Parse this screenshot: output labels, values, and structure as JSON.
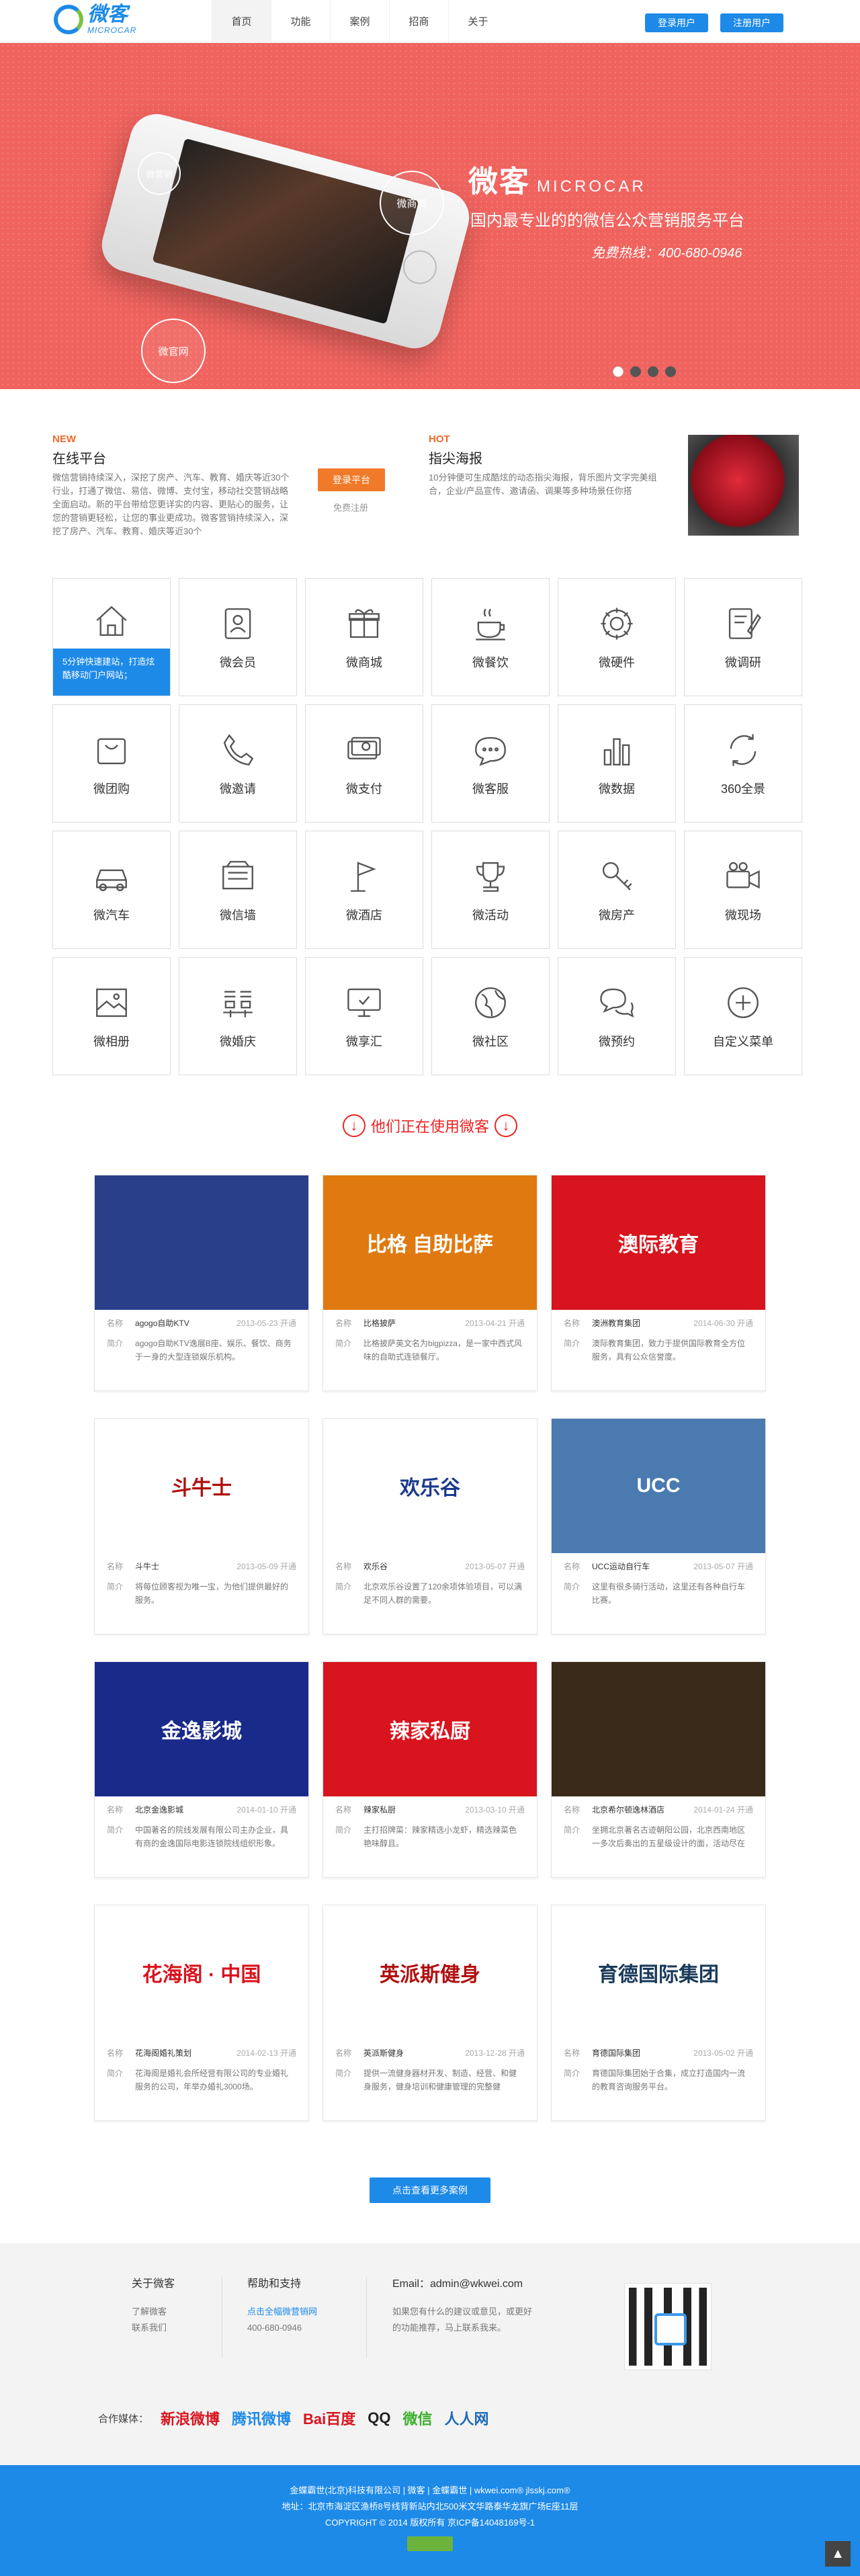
{
  "header": {
    "logo_cn": "微客",
    "logo_en": "MICROCAR",
    "nav": [
      "首页",
      "功能",
      "案例",
      "招商",
      "关于"
    ],
    "login": "登录用户",
    "register": "注册用户"
  },
  "banner": {
    "title": "微客",
    "title_en": "MICROCAR",
    "subtitle": "国内最专业的的微信公众营销服务平台",
    "hotline": "免费热线：400-680-0946",
    "bubbles": [
      "微营销",
      "微商城",
      "微官网"
    ]
  },
  "news": {
    "new_tag": "NEW",
    "new_title": "在线平台",
    "new_text": "微信营销持续深入，深挖了房产、汽车、教育、婚庆等近30个行业，打通了微信、易信、微博、支付宝，移动社交营销战略全面启动。新的平台带给您更详实的内容、更贴心的服务，让您的营销更轻松，让您的事业更成功。微客营销持续深入，深挖了房产、汽车、教育、婚庆等近30个",
    "reg_btn": "登录平台",
    "free_reg": "免费注册",
    "hot_tag": "HOT",
    "hot_title": "指尖海报",
    "hot_text": "10分钟便可生成酷炫的动态指尖海报，背乐图片文字完美组合，企业/产品宣传、邀请函、调果等多种场景任你搭"
  },
  "features": {
    "first_tip": "5分钟快速建站，打造炫酷移动门户网站；",
    "items": [
      {
        "label": "微官网",
        "icon": "home"
      },
      {
        "label": "微会员",
        "icon": "member"
      },
      {
        "label": "微商城",
        "icon": "gift"
      },
      {
        "label": "微餐饮",
        "icon": "coffee"
      },
      {
        "label": "微硬件",
        "icon": "gear"
      },
      {
        "label": "微调研",
        "icon": "pen"
      },
      {
        "label": "微团购",
        "icon": "bag"
      },
      {
        "label": "微邀请",
        "icon": "phone"
      },
      {
        "label": "微支付",
        "icon": "money"
      },
      {
        "label": "微客服",
        "icon": "chat"
      },
      {
        "label": "微数据",
        "icon": "bars"
      },
      {
        "label": "360全景",
        "icon": "rotate"
      },
      {
        "label": "微汽车",
        "icon": "car"
      },
      {
        "label": "微信墙",
        "icon": "wall"
      },
      {
        "label": "微酒店",
        "icon": "flag"
      },
      {
        "label": "微活动",
        "icon": "trophy"
      },
      {
        "label": "微房产",
        "icon": "key"
      },
      {
        "label": "微现场",
        "icon": "camera"
      },
      {
        "label": "微相册",
        "icon": "photo"
      },
      {
        "label": "微婚庆",
        "icon": "xi"
      },
      {
        "label": "微享汇",
        "icon": "monitor"
      },
      {
        "label": "微社区",
        "icon": "globe"
      },
      {
        "label": "微预约",
        "icon": "bubbles"
      },
      {
        "label": "自定义菜单",
        "icon": "plus"
      }
    ]
  },
  "cases": {
    "heading": "他们正在使用微客",
    "name_key": "名称",
    "desc_key": "简介",
    "items": [
      {
        "img_text": "",
        "bg": "#2a3f8a",
        "fg": "#fff",
        "name": "agogo自助KTV",
        "date": "2013-05-23 开通",
        "desc": "agogo自助KTV逸展B座、娱乐、餐饮、商务于一身的大型连锁娱乐机构。"
      },
      {
        "img_text": "比格 自助比萨",
        "bg": "#e07a10",
        "fg": "#fff",
        "name": "比格披萨",
        "date": "2013-04-21 开通",
        "desc": "比格披萨英文名为bigpizza，是一家中西式风味的自助式连锁餐厅。"
      },
      {
        "img_text": "澳际教育",
        "bg": "#d8141e",
        "fg": "#fff",
        "name": "澳洲教育集团",
        "date": "2014-06-30 开通",
        "desc": "澳际教育集团，致力于提供国际教育全方位服务，具有公众信誉度。"
      },
      {
        "img_text": "斗牛士",
        "bg": "#ffffff",
        "fg": "#b01010",
        "name": "斗牛士",
        "date": "2013-05-09 开通",
        "desc": "将每位顾客视为唯一宝，为他们提供最好的服务。"
      },
      {
        "img_text": "欢乐谷",
        "bg": "#ffffff",
        "fg": "#1a3a8a",
        "name": "欢乐谷",
        "date": "2013-05-07 开通",
        "desc": "北京欢乐谷设置了120余项体验项目，可以满足不同人群的需要。"
      },
      {
        "img_text": "UCC",
        "bg": "#4a7ab0",
        "fg": "#fff",
        "name": "UCC运动自行车",
        "date": "2013-05-07 开通",
        "desc": "这里有很多骑行活动，这里还有各种自行车比赛。"
      },
      {
        "img_text": "金逸影城",
        "bg": "#1a2a8a",
        "fg": "#fff",
        "name": "北京金逸影城",
        "date": "2014-01-10 开通",
        "desc": "中国著名的院线发展有限公司主办企业，具有商的金逸国际电影连锁院线组织形象。"
      },
      {
        "img_text": "辣家私厨",
        "bg": "#d8141e",
        "fg": "#fff",
        "name": "辣家私厨",
        "date": "2013-03-10 开通",
        "desc": "主打招牌菜：辣家精选小龙虾，精选辣菜色艳味醇且。"
      },
      {
        "img_text": "",
        "bg": "#3a2a1a",
        "fg": "#fff",
        "name": "北京希尔顿逸林酒店",
        "date": "2014-01-24 开通",
        "desc": "坐拥北京著名古迹朝阳公园，北京西南地区一多次后奏出的五星级设计的面，活动尽在其中的希尔顿逸林酒店。"
      },
      {
        "img_text": "花海阁 · 中国",
        "bg": "#ffffff",
        "fg": "#d8141e",
        "name": "花海阁婚礼策划",
        "date": "2014-02-13 开通",
        "desc": "花海阁是婚礼会所经营有限公司的专业婚礼服务的公司，年举办婚礼3000场。"
      },
      {
        "img_text": "英派斯健身",
        "bg": "#ffffff",
        "fg": "#b01010",
        "name": "英派斯健身",
        "date": "2013-12-28 开通",
        "desc": "提供一流健身器材开发、制造、经营、和健身服务，健身培训和健康管理的完整健康……"
      },
      {
        "img_text": "育德国际集团",
        "bg": "#ffffff",
        "fg": "#1a3a5a",
        "name": "育德国际集团",
        "date": "2013-05-02 开通",
        "desc": "育德国际集团始于合集，成立打造国内一流的教育咨询服务平台。"
      }
    ],
    "more_btn": "点击查看更多案例"
  },
  "footer": {
    "about_title": "关于微客",
    "about_links": [
      "了解微客",
      "联系我们"
    ],
    "help_title": "帮助和支持",
    "help_links": [
      "点击全幅微营销网",
      "400-680-0946"
    ],
    "email_title": "Email：admin@wkwei.com",
    "email_text": "如果您有什么的建议或意见，或更好的功能推荐，马上联系我来。",
    "partners_label": "合作媒体：",
    "partners": [
      "新浪微博",
      "腾讯微博",
      "Bai百度",
      "QQ",
      "微信",
      "人人网"
    ],
    "bottom_line1": "金蝶霸世(北京)科技有限公司 | 微客 | 金蝶霸世 | wkwei.com® jlsskj.com®",
    "bottom_line2": "地址：北京市海淀区渔桥8号线背新站内北500米文华路泰华龙旗广场E座11层",
    "bottom_line3": "COPYRIGHT © 2014 版权所有 京ICP备14048169号-1",
    "gotop": "▲"
  },
  "colors": {
    "brand": "#1d8ae8",
    "banner": "#f0635e",
    "accent": "#f07a2a",
    "red": "#e22222"
  }
}
